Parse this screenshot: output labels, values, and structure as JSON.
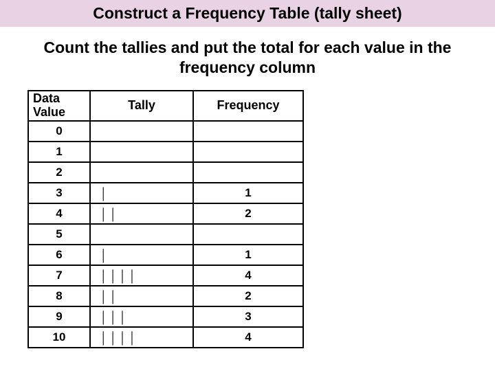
{
  "title": "Construct a Frequency Table (tally sheet)",
  "subtitle": "Count the tallies and put the total for each value in the frequency column",
  "headers": {
    "data_value": "Data Value",
    "tally": "Tally",
    "frequency": "Frequency"
  },
  "rows": [
    {
      "value": "0",
      "tally": "",
      "frequency": ""
    },
    {
      "value": "1",
      "tally": "",
      "frequency": ""
    },
    {
      "value": "2",
      "tally": "",
      "frequency": ""
    },
    {
      "value": "3",
      "tally": "|",
      "frequency": "1"
    },
    {
      "value": "4",
      "tally": "| |",
      "frequency": "2"
    },
    {
      "value": "5",
      "tally": "",
      "frequency": ""
    },
    {
      "value": "6",
      "tally": "|",
      "frequency": "1"
    },
    {
      "value": "7",
      "tally": "| | | |",
      "frequency": "4"
    },
    {
      "value": "8",
      "tally": "| |",
      "frequency": "2"
    },
    {
      "value": "9",
      "tally": "| | |",
      "frequency": "3"
    },
    {
      "value": "10",
      "tally": "| | | |",
      "frequency": "4"
    }
  ],
  "chart_data": {
    "type": "table",
    "title": "Frequency Table (tally sheet)",
    "columns": [
      "Data Value",
      "Tally",
      "Frequency"
    ],
    "categories": [
      "0",
      "1",
      "2",
      "3",
      "4",
      "5",
      "6",
      "7",
      "8",
      "9",
      "10"
    ],
    "values": [
      null,
      null,
      null,
      1,
      2,
      null,
      1,
      4,
      2,
      3,
      4
    ]
  }
}
